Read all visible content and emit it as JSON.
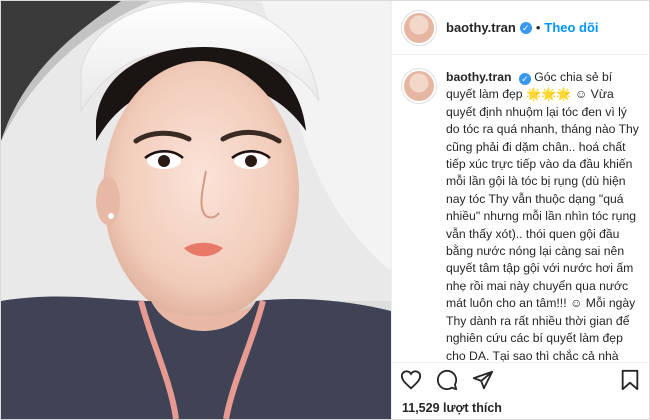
{
  "header": {
    "username": "baothy.tran",
    "verified_icon": "verified-badge-icon",
    "separator": "•",
    "follow_label": "Theo dõi"
  },
  "caption": {
    "username": "baothy.tran",
    "text": "Góc chia sẻ bí quyết làm đẹp 🌟🌟🌟 ☺ Vừa quyết định nhuộm lại tóc đen vì lý do tóc ra quá nhanh, tháng nào Thy cũng phải đi dặm chân.. hoá chất tiếp xúc trực tiếp vào da đầu khiến mỗi lần gội là tóc bị rụng (dù hiện nay tóc Thy vẫn thuộc dạng \"quá nhiều\" nhưng mỗi lần nhìn tóc rụng vẫn thấy xót).. thói quen gội đầu bằng nước nóng lại càng sai nên quyết tâm tập gội với nước hơi ấm nhẹ rồi mai này chuyển qua nước mát luôn cho an tâm!!! ☺ Mỗi ngày Thy dành ra rất nhiều thời gian để nghiên cứu các bí quyết làm đẹp cho DA. Tại sao thì chắc cả nhà cũng đã hiểu rồi :\") nhưng Thy có các tuyệt chiêu sau đây đúc kết từ chính bản thân mình để có được làn da như ngày hôm nay"
  },
  "actions": {
    "like_icon": "heart-icon",
    "comment_icon": "comment-icon",
    "share_icon": "share-icon",
    "save_icon": "bookmark-icon"
  },
  "likes": {
    "text": "11,529 lượt thích"
  },
  "colors": {
    "accent": "#0095f6",
    "verified": "#3897f0",
    "border": "#dbdbdb"
  }
}
